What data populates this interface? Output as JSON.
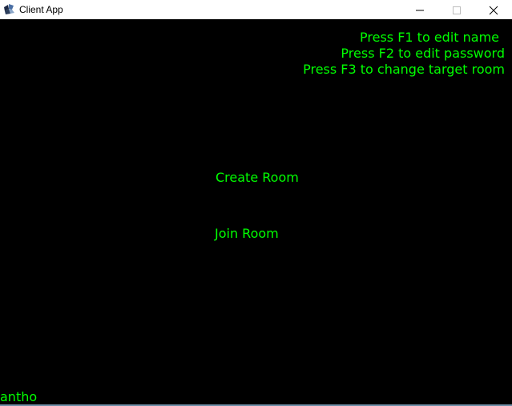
{
  "window": {
    "title": "Client App",
    "icon": "app-icon",
    "controls": {
      "minimize_icon": "minimize-icon",
      "maximize_icon": "maximize-icon",
      "close_icon": "close-icon"
    }
  },
  "theme": {
    "background": "#000000",
    "text_color": "#00ff00"
  },
  "hints": {
    "f1": "Press F1 to edit name",
    "f2": "Press F2 to edit password",
    "f3": "Press F3 to change target room"
  },
  "menu": {
    "create_room": "Create Room",
    "join_room": "Join Room"
  },
  "status": {
    "username": "antho"
  }
}
